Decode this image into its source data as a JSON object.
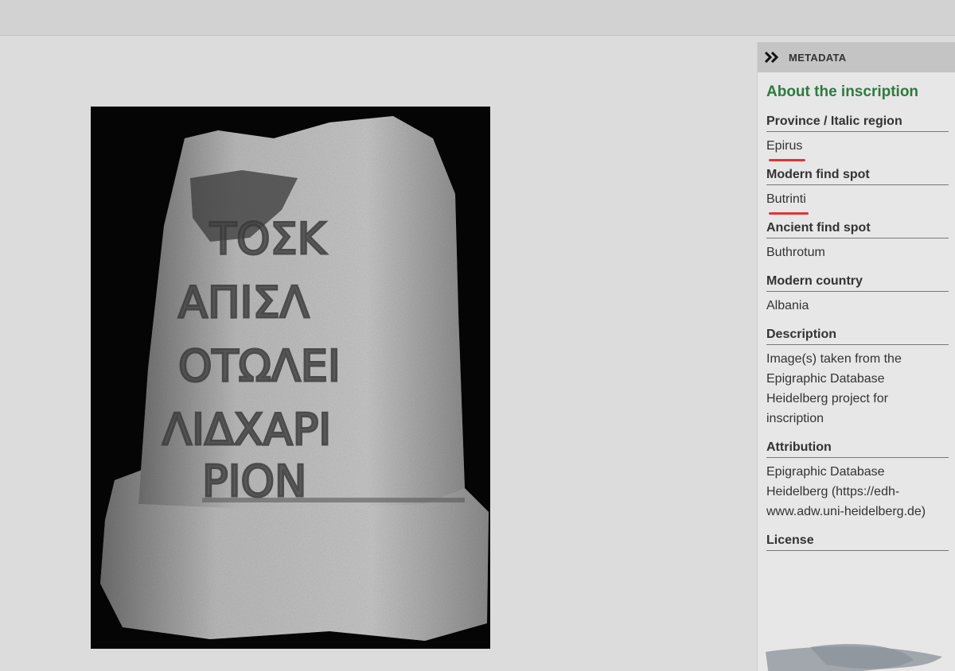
{
  "panel": {
    "header_label": "METADATA",
    "header_icon": "double-chevron-right-icon",
    "section_title": "About the inscription",
    "fields": [
      {
        "label": "Province / Italic region",
        "value": "Epirus"
      },
      {
        "label": "Modern find spot",
        "value": "Butrinti"
      },
      {
        "label": "Ancient find spot",
        "value": "Buthrotum"
      },
      {
        "label": "Modern country",
        "value": "Albania"
      },
      {
        "label": "Description",
        "value": "Image(s) taken from the Epigraphic Database Heidelberg project for inscription"
      },
      {
        "label": "Attribution",
        "value": "Epigraphic Database Heidelberg (https://edh-www.adw.uni-heidelberg.de)"
      },
      {
        "label": "License",
        "value": ""
      }
    ]
  },
  "photo": {
    "subject": "Greek inscribed stone",
    "inscription_lines": [
      "ΤΟΣΚ",
      "ΑΠΙΣΛ",
      "ΟΤΩΛΕΙ",
      "ΛΙΔΧΑΡΙ",
      "ΡΙΟΝ"
    ]
  },
  "colors": {
    "accent_green": "#2e7a40",
    "annotation_red": "#e03535",
    "panel_header_bg": "#c4c4c4"
  }
}
